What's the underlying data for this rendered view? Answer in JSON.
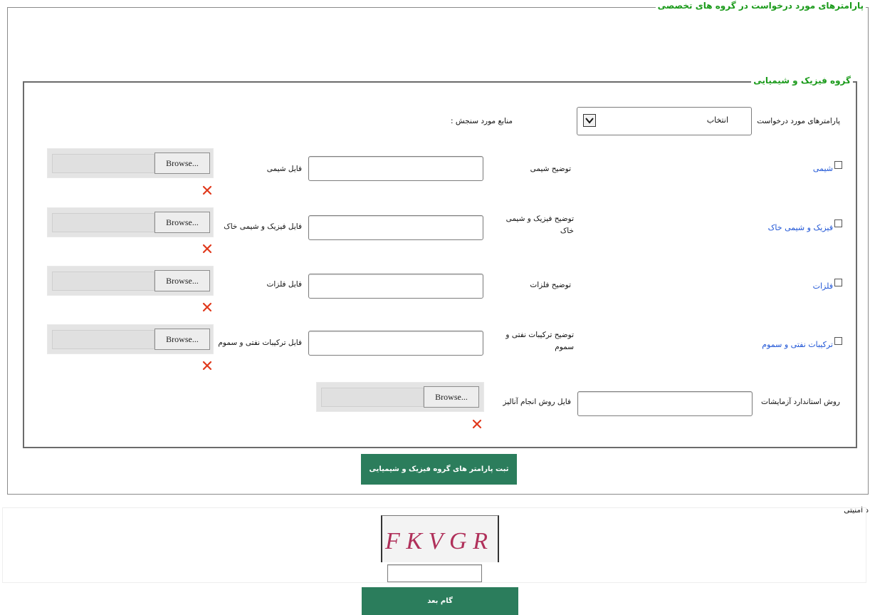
{
  "outer_legend": "پارامترهای مورد درخواست در گروه های تخصصی",
  "inner_legend": "گروه فیزیک و شیمیایی",
  "params_label": "پارامترهای مورد درخواست",
  "params_select_value": "انتخاب",
  "source_label": "منابع مورد سنجش :",
  "rows": [
    {
      "check_label": "شیمی",
      "desc_label": "توضیح شیمی",
      "file_label": "فایل شیمی",
      "browse": "Browse..."
    },
    {
      "check_label": "فیزیک و شیمی خاک",
      "desc_label": "توضیح فیزیک و شیمی خاک",
      "file_label": "فایل فیزیک و شیمی خاک",
      "browse": "Browse..."
    },
    {
      "check_label": "فلزات",
      "desc_label": "توضیح فلزات",
      "file_label": "فایل فلزات",
      "browse": "Browse..."
    },
    {
      "check_label": "ترکیبات نفتی و سموم",
      "desc_label": "توضیح ترکیبات نفتی و سموم",
      "file_label": "فایل ترکیبات نفتی و سموم",
      "browse": "Browse..."
    }
  ],
  "standard_method_label": "روش استاندارد آزمایشات",
  "analysis_file_label": "فایل روش انجام آنالیز",
  "analysis_browse": "Browse...",
  "submit_button": "ثبت پارامتر های گروه فیزیک و شیمیایی",
  "security_label": "د امنیتی",
  "captcha_text": "FKVGR",
  "next_button": "گام بعد",
  "colors": {
    "legend_green": "#1a9a1a",
    "button_green": "#2b7d5c",
    "link_blue": "#1f55d6",
    "remove_red": "#e0391c"
  }
}
